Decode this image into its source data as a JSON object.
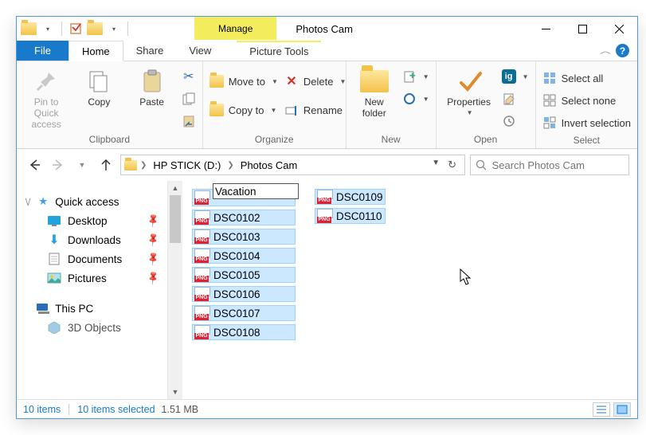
{
  "titlebar": {
    "context_tab": "Manage",
    "title": "Photos Cam"
  },
  "tabs": {
    "file": "File",
    "home": "Home",
    "share": "Share",
    "view": "View",
    "picture_tools": "Picture Tools"
  },
  "ribbon": {
    "clipboard": {
      "pin": "Pin to Quick access",
      "copy": "Copy",
      "paste": "Paste",
      "label": "Clipboard"
    },
    "organize": {
      "move_to": "Move to",
      "copy_to": "Copy to",
      "delete": "Delete",
      "rename": "Rename",
      "label": "Organize"
    },
    "new": {
      "new_folder": "New folder",
      "label": "New"
    },
    "open": {
      "properties": "Properties",
      "label": "Open"
    },
    "select": {
      "select_all": "Select all",
      "select_none": "Select none",
      "invert": "Invert selection",
      "label": "Select"
    }
  },
  "addressbar": {
    "crumb1": "HP STICK (D:)",
    "crumb2": "Photos Cam"
  },
  "search": {
    "placeholder": "Search Photos Cam"
  },
  "navpane": {
    "quick_access": "Quick access",
    "desktop": "Desktop",
    "downloads": "Downloads",
    "documents": "Documents",
    "pictures": "Pictures",
    "this_pc": "This PC",
    "objects3d": "3D Objects"
  },
  "files": {
    "rename_value": "Vacation",
    "col1": [
      "DSC0102",
      "DSC0103",
      "DSC0104",
      "DSC0105",
      "DSC0106",
      "DSC0107",
      "DSC0108"
    ],
    "col2": [
      "DSC0109",
      "DSC0110"
    ]
  },
  "status": {
    "items": "10 items",
    "selected": "10 items selected",
    "size": "1.51 MB"
  }
}
